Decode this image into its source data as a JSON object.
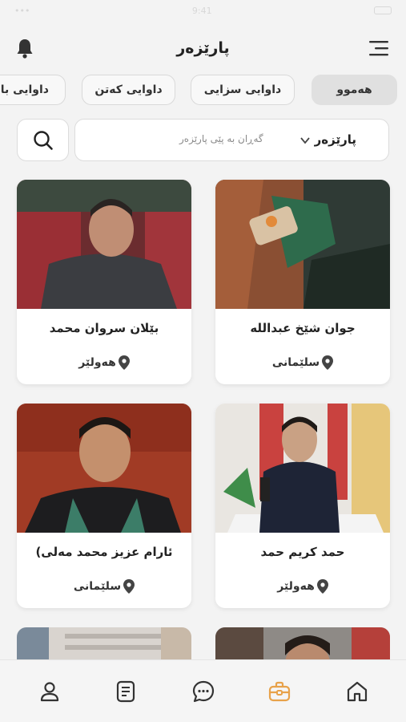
{
  "status_bar": {
    "time": "9:41"
  },
  "header": {
    "title": "پارێزەر"
  },
  "filters": [
    {
      "label": "هەموو",
      "active": true
    },
    {
      "label": "داوایی سزایی",
      "active": false
    },
    {
      "label": "داوایی کەتن",
      "active": false
    },
    {
      "label": "داوایی بار",
      "active": false
    }
  ],
  "search": {
    "filter_label": "پارێزەر",
    "placeholder": "گەڕان بە پێی پارێزەر"
  },
  "lawyers": [
    {
      "name": "جوان شێخ عبدالله",
      "location": "سلێمانی"
    },
    {
      "name": "بێلان سروان محمد",
      "location": "هەولێر"
    },
    {
      "name": "حمد کریم حمد",
      "location": "هەولێر"
    },
    {
      "name": "ئارام عزیز محمد مەلی)",
      "location": "سلێمانی"
    }
  ],
  "colors": {
    "accent": "#E8A24A",
    "icon": "#333333",
    "chip_active": "#E0E0E0"
  },
  "tabbar": {
    "items": [
      {
        "icon": "home-icon",
        "active": false
      },
      {
        "icon": "briefcase-icon",
        "active": true
      },
      {
        "icon": "chat-icon",
        "active": false
      },
      {
        "icon": "document-icon",
        "active": false
      },
      {
        "icon": "profile-icon",
        "active": false
      }
    ]
  }
}
